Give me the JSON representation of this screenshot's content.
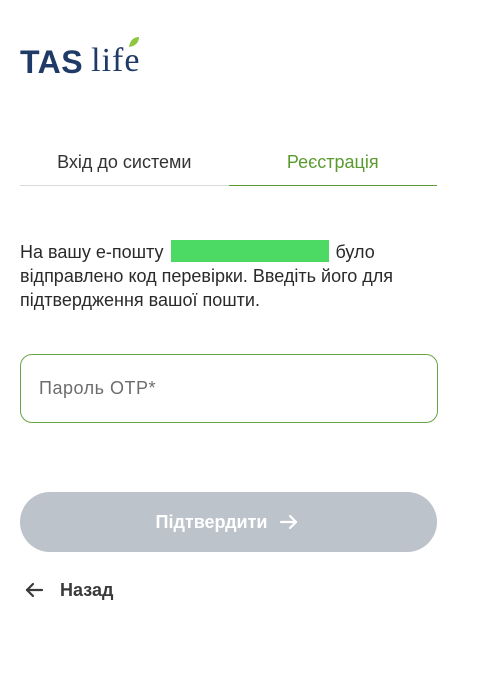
{
  "logo": {
    "brand": "TAS",
    "suffix": "life",
    "brand_color": "#1e3a66",
    "leaf_color": "#8dc63f"
  },
  "tabs": [
    {
      "label": "Вхід до системи",
      "active": false
    },
    {
      "label": "Реєстрація",
      "active": true
    }
  ],
  "message": {
    "before": "На вашу e-пошту",
    "after": "було відправлено код перевірки. Введіть його для підтвердження вашої пошти."
  },
  "otp": {
    "placeholder": "Пароль OTP*",
    "value": ""
  },
  "confirm_button": {
    "label": "Підтвердити",
    "icon": "arrow-right-icon",
    "disabled": true
  },
  "back_link": {
    "label": "Назад",
    "icon": "arrow-left-icon"
  },
  "colors": {
    "accent": "#5a9b2f",
    "button_disabled": "#bcc3ca",
    "redaction": "#4cd964"
  }
}
